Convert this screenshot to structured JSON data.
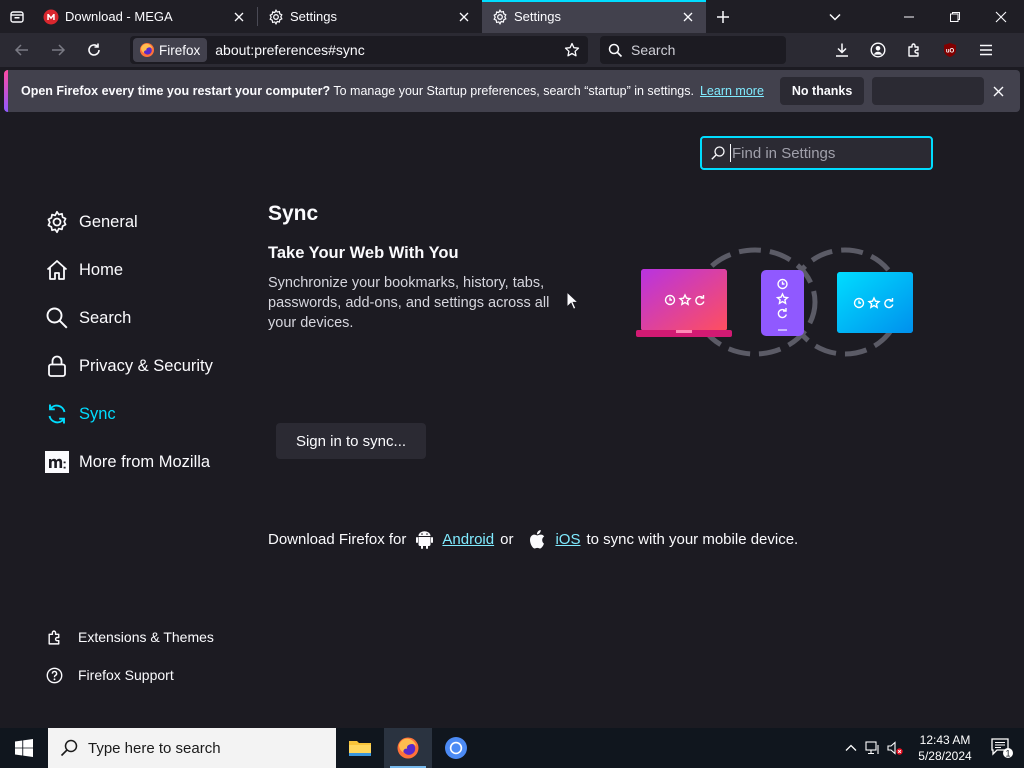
{
  "tabs": [
    {
      "title": "Download - MEGA",
      "icon": "mega-icon",
      "active": false
    },
    {
      "title": "Settings",
      "icon": "gear-icon",
      "active": false
    },
    {
      "title": "Settings",
      "icon": "gear-icon",
      "active": true
    }
  ],
  "navbar": {
    "identity_label": "Firefox",
    "url": "about:preferences#sync",
    "search_placeholder": "Search"
  },
  "notification": {
    "bold_text": "Open Firefox every time you restart your computer?",
    "text": " To manage your Startup preferences, search “startup” in settings.",
    "link": "Learn more",
    "button": "No thanks"
  },
  "find": {
    "placeholder": "Find in Settings"
  },
  "sidebar": {
    "items": [
      {
        "label": "General",
        "icon": "gear-icon"
      },
      {
        "label": "Home",
        "icon": "home-icon"
      },
      {
        "label": "Search",
        "icon": "search-icon"
      },
      {
        "label": "Privacy & Security",
        "icon": "lock-icon"
      },
      {
        "label": "Sync",
        "icon": "sync-icon",
        "selected": true
      },
      {
        "label": "More from Mozilla",
        "icon": "mozilla-icon"
      }
    ],
    "bottom": [
      {
        "label": "Extensions & Themes",
        "icon": "puzzle-icon"
      },
      {
        "label": "Firefox Support",
        "icon": "help-icon"
      }
    ]
  },
  "main": {
    "title": "Sync",
    "subtitle": "Take Your Web With You",
    "description": "Synchronize your bookmarks, history, tabs, passwords, add-ons, and settings across all your devices.",
    "sign_in_button": "Sign in to sync...",
    "download": {
      "prefix": "Download Firefox for",
      "android": "Android",
      "or": "or",
      "ios": "iOS",
      "suffix": "to sync with your mobile device."
    }
  },
  "taskbar": {
    "search_placeholder": "Type here to search",
    "time": "12:43 AM",
    "date": "5/28/2024",
    "notification_count": "1"
  },
  "colors": {
    "accent": "#00ddff",
    "link": "#80ebff",
    "background": "#1c1b22"
  }
}
